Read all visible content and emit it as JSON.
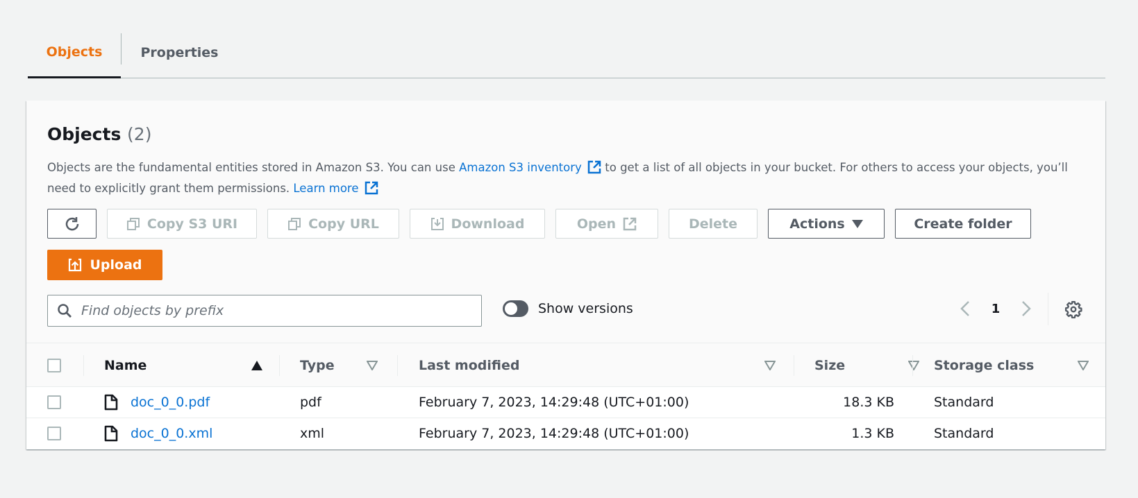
{
  "tabs": [
    {
      "label": "Objects",
      "active": true
    },
    {
      "label": "Properties",
      "active": false
    }
  ],
  "panel": {
    "title": "Objects",
    "count": "(2)",
    "description": {
      "part1": "Objects are the fundamental entities stored in Amazon S3. You can use ",
      "link1": "Amazon S3 inventory",
      "part2": " to get a list of all objects in your bucket. For others to access your objects, you’ll need to explicitly grant them permissions. ",
      "link2": "Learn more"
    }
  },
  "toolbar": {
    "refresh_icon": "refresh-icon",
    "copy_s3_uri": "Copy S3 URI",
    "copy_url": "Copy URL",
    "download": "Download",
    "open": "Open",
    "delete": "Delete",
    "actions": "Actions",
    "create_folder": "Create folder",
    "upload": "Upload"
  },
  "search": {
    "placeholder": "Find objects by prefix",
    "value": ""
  },
  "show_versions": {
    "label": "Show versions",
    "enabled": false
  },
  "pagination": {
    "current_page": "1"
  },
  "table": {
    "columns": [
      "Name",
      "Type",
      "Last modified",
      "Size",
      "Storage class"
    ],
    "rows": [
      {
        "name": "doc_0_0.pdf",
        "type": "pdf",
        "last_modified": "February 7, 2023, 14:29:48 (UTC+01:00)",
        "size": "18.3 KB",
        "storage_class": "Standard"
      },
      {
        "name": "doc_0_0.xml",
        "type": "xml",
        "last_modified": "February 7, 2023, 14:29:48 (UTC+01:00)",
        "size": "1.3 KB",
        "storage_class": "Standard"
      }
    ]
  },
  "colors": {
    "accent": "#ec7211",
    "link": "#0972d3",
    "text": "#16191f",
    "muted": "#545b64",
    "disabled": "#aab7b8"
  }
}
